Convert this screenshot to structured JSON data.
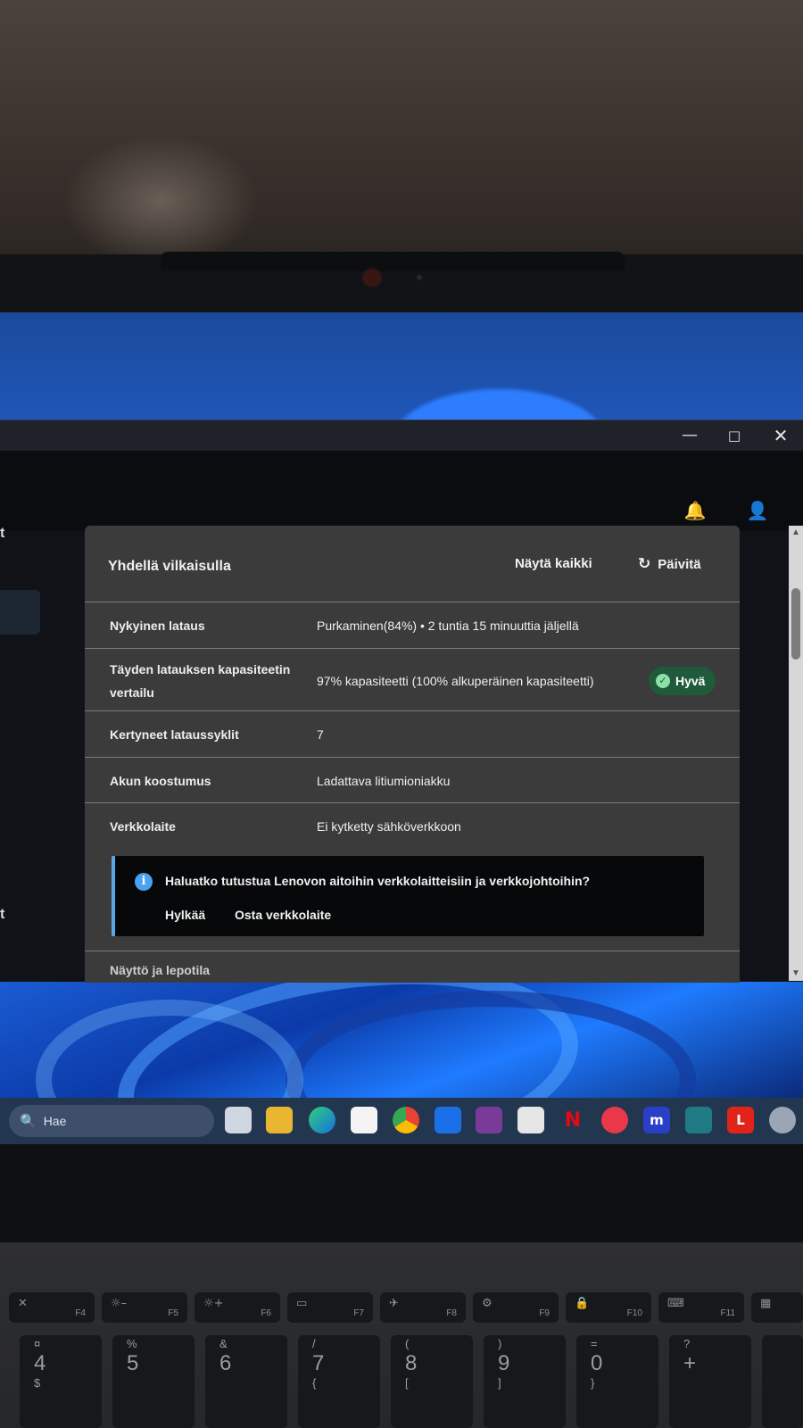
{
  "window": {
    "minimize_icon": "minimize-icon",
    "maximize_icon": "maximize-icon",
    "close_icon": "close-icon"
  },
  "header": {
    "bell_icon": "bell-icon",
    "user_icon": "user-icon"
  },
  "sidebar": {
    "edge_char_1": "t",
    "edge_char_2": "t"
  },
  "card": {
    "title": "Yhdellä vilkaisulla",
    "show_all": "Näytä kaikki",
    "refresh": "Päivitä",
    "rows": [
      {
        "label": "Nykyinen lataus",
        "value": "Purkaminen(84%)  •  2 tuntia 15 minuuttia jäljellä"
      },
      {
        "label": "Täyden latauksen kapasiteetin vertailu",
        "value": "97% kapasiteetti (100% alkuperäinen kapasiteetti)",
        "badge": "Hyvä"
      },
      {
        "label": "Kertyneet lataussyklit",
        "value": "7"
      },
      {
        "label": "Akun koostumus",
        "value": "Ladattava litiumioniakku"
      },
      {
        "label": "Verkkolaite",
        "value": "Ei kytketty sähköverkkoon"
      }
    ],
    "notice": {
      "message": "Haluatko tutustua Lenovon aitoihin verkkolaitteisiin ja verkkojohtoihin?",
      "reject": "Hylkää",
      "buy": "Osta verkkolaite"
    },
    "next_section": "Näyttö ja lepotila"
  },
  "colors": {
    "badge_bg": "#1f5b3b",
    "notice_accent": "#5aa7e8",
    "card_bg": "#3b3b3c"
  },
  "taskbar": {
    "search_placeholder": "Hae",
    "apps": [
      "task-view",
      "file-explorer",
      "edge",
      "store",
      "chrome",
      "dropbox",
      "app-purple",
      "app-white",
      "netflix",
      "app-red",
      "app-m",
      "app-disney",
      "lenovo-vantage",
      "settings"
    ]
  },
  "keyboard": {
    "fkeys": [
      "F4",
      "F5",
      "F6",
      "F7",
      "F8",
      "F9",
      "F10",
      "F11"
    ],
    "numkeys": [
      {
        "top": "¤",
        "main": "4",
        "bottom": "$"
      },
      {
        "top": "%",
        "main": "5",
        "bottom": ""
      },
      {
        "top": "&",
        "main": "6",
        "bottom": ""
      },
      {
        "top": "/",
        "main": "7",
        "bottom": "{"
      },
      {
        "top": "(",
        "main": "8",
        "bottom": "["
      },
      {
        "top": ")",
        "main": "9",
        "bottom": "]"
      },
      {
        "top": "=",
        "main": "0",
        "bottom": "}"
      },
      {
        "top": "?",
        "main": "+",
        "bottom": ""
      }
    ]
  }
}
